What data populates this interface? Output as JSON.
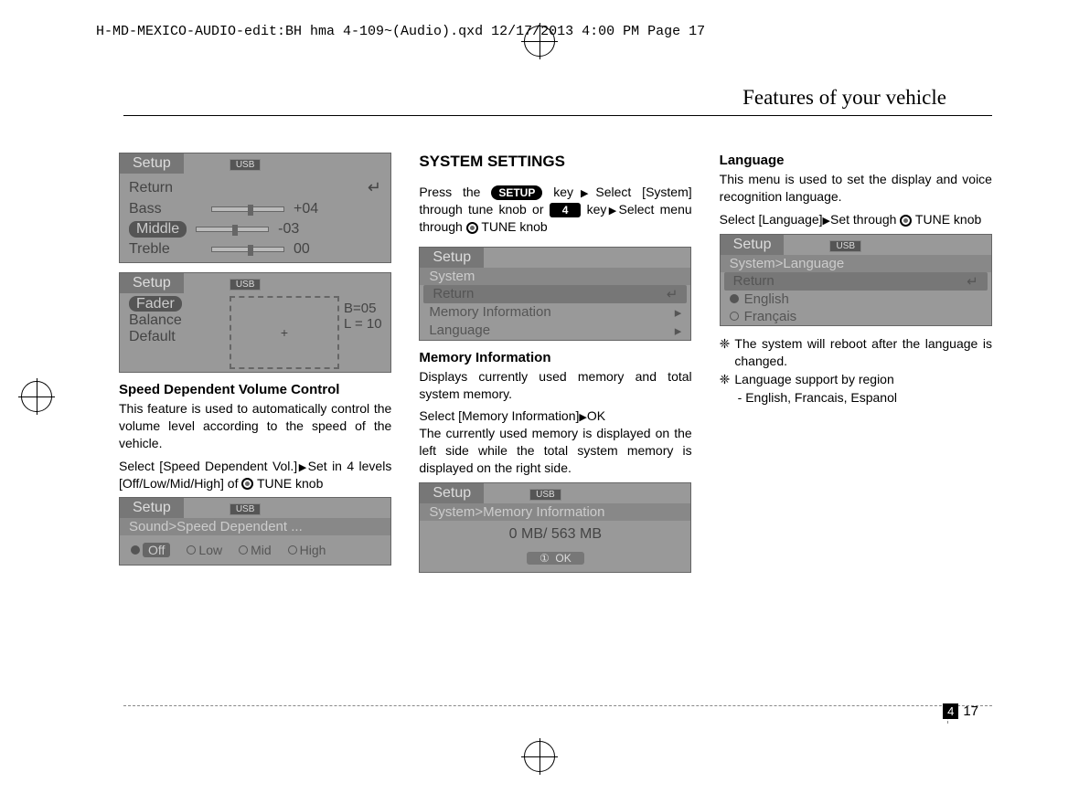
{
  "header_meta": "H-MD-MEXICO-AUDIO-edit:BH hma 4-109~(Audio).qxd  12/17/2013  4:00 PM  Page 17",
  "page_header": "Features of your vehicle",
  "page_number_section": "4",
  "page_number": "17",
  "col1": {
    "lcd1": {
      "tab": "Setup",
      "usb": "USB",
      "return": "Return",
      "bass": "Bass",
      "bass_val": "+04",
      "middle": "Middle",
      "middle_val": "-03",
      "treble": "Treble",
      "treble_val": "00"
    },
    "lcd2": {
      "tab": "Setup",
      "usb": "USB",
      "fader": "Fader",
      "balance": "Balance",
      "default": "Default",
      "b": "B=05",
      "l": "L = 10"
    },
    "section1_title": "Speed Dependent Volume Control",
    "section1_p1": "This feature is used to automatically control the volume level according to the speed of the vehicle.",
    "section1_p2a": "Select [Speed Dependent Vol.]",
    "section1_p2b": "Set in 4 levels [Off/Low/Mid/High] of ",
    "section1_p2c": "TUNE knob",
    "lcd3": {
      "tab": "Setup",
      "usb": "USB",
      "title": "Sound>Speed Dependent ...",
      "off": "Off",
      "low": "Low",
      "mid": "Mid",
      "high": "High"
    }
  },
  "col2": {
    "heading": "SYSTEM SETTINGS",
    "p1a": "Press the ",
    "setup_btn": "SETUP",
    "p1b": " key",
    "p1c": "Select [System] through tune knob or ",
    "num_btn": "4",
    "p1d": " key",
    "p1e": "Select menu through ",
    "p1f": "TUNE knob",
    "lcd4": {
      "tab": "Setup",
      "system": "System",
      "return": "Return",
      "mem": "Memory Information",
      "lang": "Language"
    },
    "section2_title": "Memory Information",
    "section2_p1": "Displays currently used memory and total system memory.",
    "section2_p2a": "Select [Memory Information]",
    "section2_p2b": "OK",
    "section2_p3": "The currently used memory is displayed on the left side while the total system memory is displayed on the right side.",
    "lcd5": {
      "tab": "Setup",
      "usb": "USB",
      "title": "System>Memory Information",
      "value": "0 MB/ 563 MB",
      "ok_num": "①",
      "ok": "OK"
    }
  },
  "col3": {
    "section3_title": "Language",
    "section3_p1": "This menu is used to set the display and voice recognition language.",
    "section3_p2a": "Select [Language]",
    "section3_p2b": "Set through ",
    "section3_p2c": " TUNE knob",
    "lcd6": {
      "tab": "Setup",
      "usb": "USB",
      "title": "System>Language",
      "return": "Return",
      "english": "English",
      "francais": "Français"
    },
    "note1": "The system will reboot after the language is changed.",
    "note2": "Language support by region",
    "note2_sub": "- English, Francais, Espanol"
  }
}
